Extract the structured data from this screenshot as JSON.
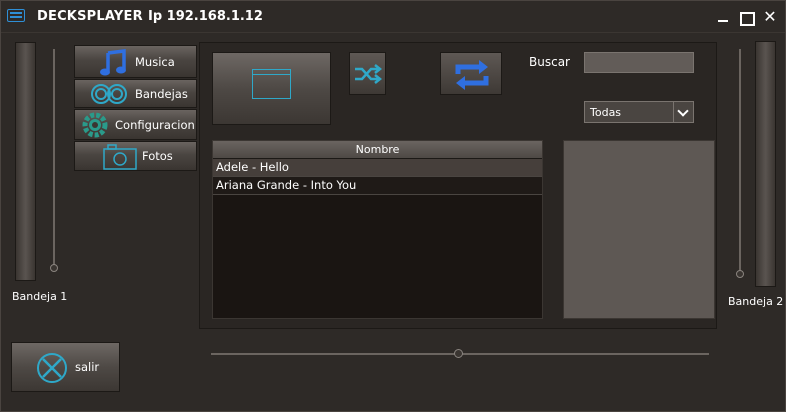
{
  "window": {
    "app_title": "DECKSPLAYER",
    "ip_label": "Ip 192.168.1.12",
    "close_glyph": "✕"
  },
  "trays": {
    "left_label": "Bandeja 1",
    "right_label": "Bandeja 2"
  },
  "nav": {
    "items": [
      {
        "label": "Musica",
        "icon": "music-note-icon"
      },
      {
        "label": "Bandejas",
        "icon": "spiral-icon"
      },
      {
        "label": "Configuracion",
        "icon": "gear-icon"
      },
      {
        "label": "Fotos",
        "icon": "camera-icon"
      }
    ]
  },
  "toolbar": {
    "open_icon": "folder-icon",
    "shuffle_icon": "shuffle-icon",
    "repeat_icon": "repeat-icon"
  },
  "search": {
    "label": "Buscar",
    "value": ""
  },
  "filter": {
    "selected": "Todas"
  },
  "song_list": {
    "column_header": "Nombre",
    "rows": [
      "Adele - Hello",
      "Ariana Grande - Into You"
    ],
    "selected_index": 0
  },
  "exit": {
    "label": "salir",
    "icon": "exit-cross-icon"
  },
  "colors": {
    "accent_cyan": "#2fa8c8",
    "accent_blue": "#2f6fe0",
    "background": "#2e2a27"
  }
}
